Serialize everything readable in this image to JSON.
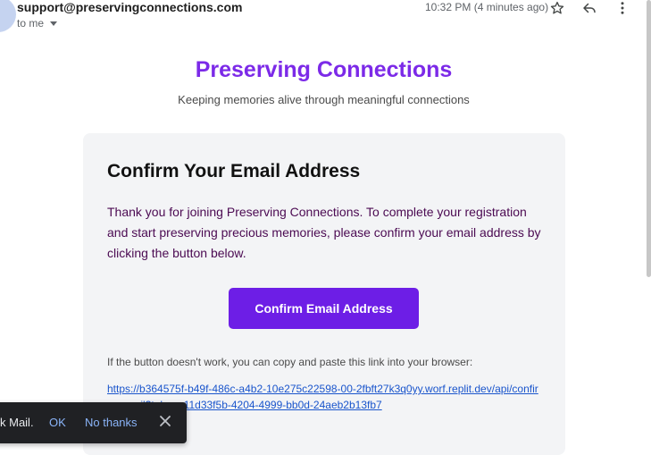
{
  "header": {
    "sender": "support@preservingconnections.com",
    "to_label": "to me",
    "timestamp": "10:32 PM (4 minutes ago)"
  },
  "icons": {
    "star": "star-icon",
    "reply": "reply-icon",
    "more": "more-vert-icon",
    "caret": "chevron-down-icon",
    "close": "close-icon"
  },
  "email": {
    "brand_title": "Preserving Connections",
    "brand_tagline": "Keeping memories alive through meaningful connections",
    "card_title": "Confirm Your Email Address",
    "card_body": "Thank you for joining Preserving Connections. To complete your registration and start preserving precious memories, please confirm your email address by clicking the button below.",
    "button_label": "Confirm Email Address",
    "fallback_text": "If the button doesn't work, you can copy and paste this link into your browser:",
    "fallback_link": "https://b364575f-b49f-486c-a4b2-10e275c22598-00-2fbft27k3q0yy.worf.replit.dev/api/confirm-email?token=11d33f5b-4204-4999-bb0d-24aeb2b13fb7"
  },
  "snackbar": {
    "message_fragment": "k Mail.",
    "ok_label": "OK",
    "no_thanks_label": "No thanks"
  },
  "colors": {
    "brand_purple": "#7c2ae8",
    "button_purple": "#6d1ee6",
    "body_text": "#4b0a52",
    "link_blue": "#1a55cc"
  }
}
